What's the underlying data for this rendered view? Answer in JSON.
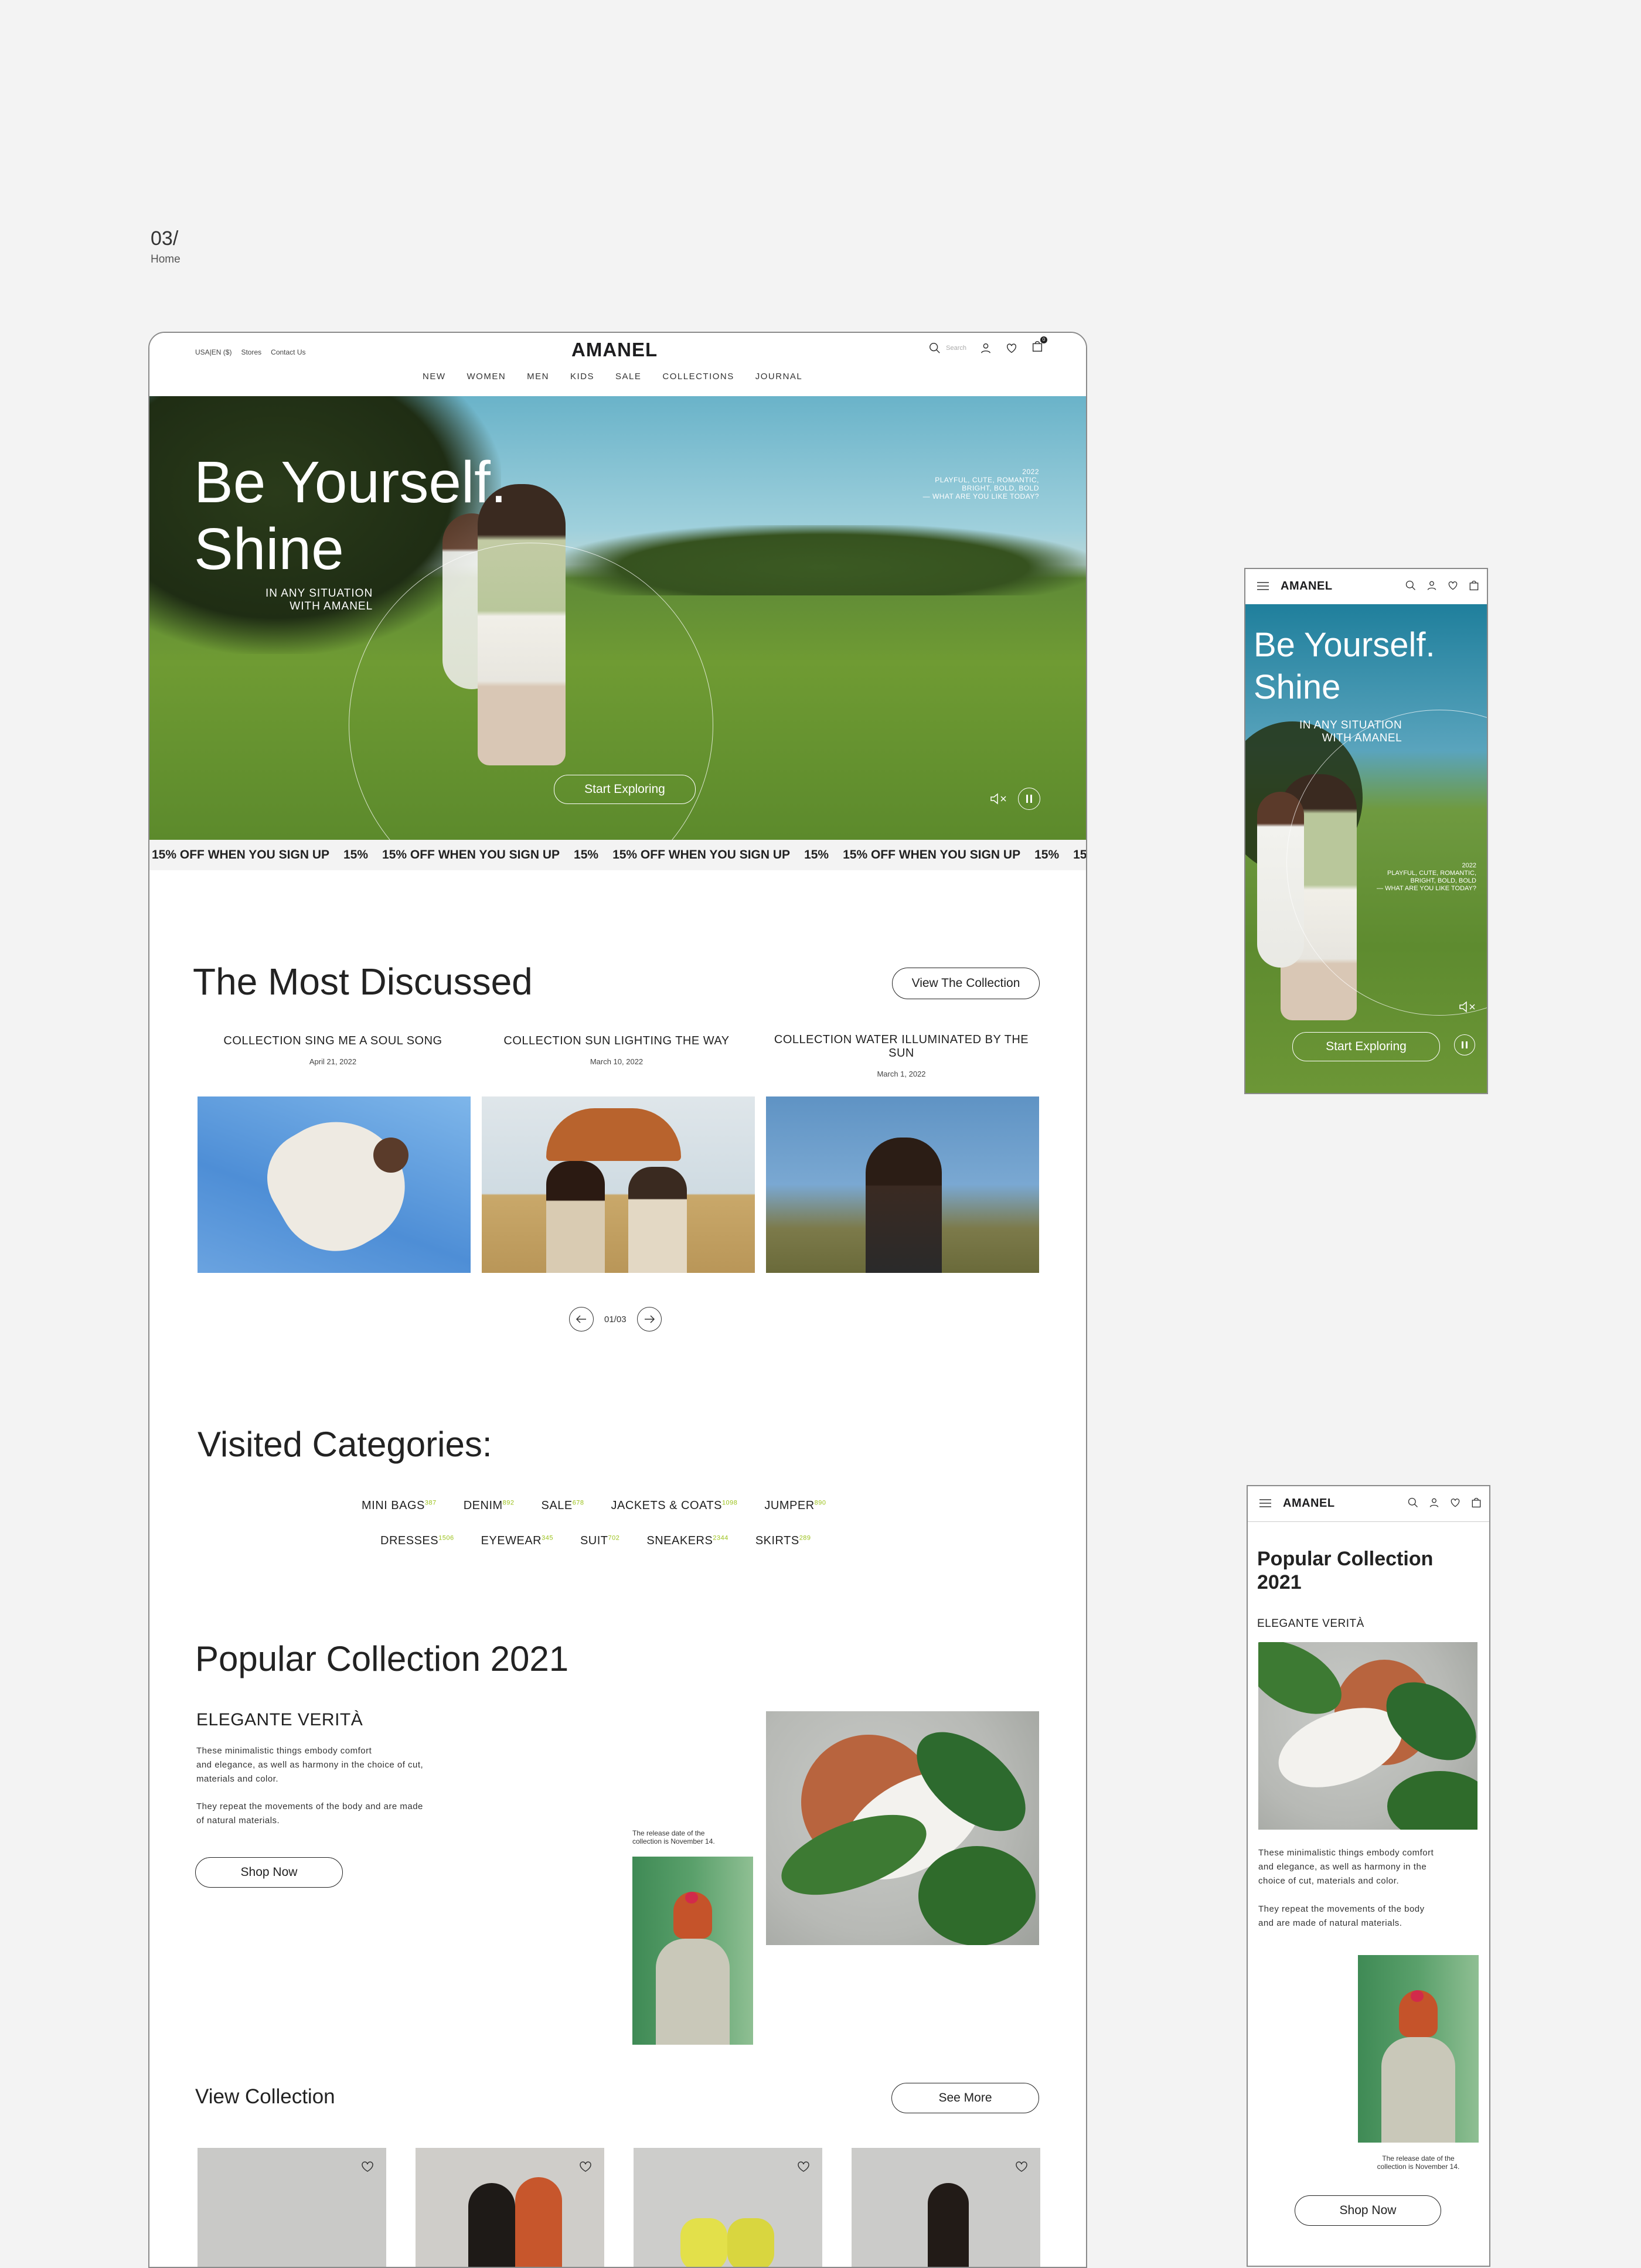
{
  "page": {
    "number": "03/",
    "name": "Home"
  },
  "desktop": {
    "topbar": {
      "locale": "USA|EN ($)",
      "stores": "Stores",
      "contact": "Contact Us",
      "logo": "AMANEL",
      "search_placeholder": "Search",
      "cart_count": "0"
    },
    "nav": [
      "NEW",
      "WOMEN",
      "MEN",
      "KIDS",
      "SALE",
      "COLLECTIONS",
      "JOURNAL"
    ],
    "hero": {
      "title_line1": "Be Yourself.",
      "title_line2": "Shine",
      "sub_line1": "IN ANY SITUATION",
      "sub_line2": "WITH AMANEL",
      "side_line1": "2022",
      "side_line2": "PLAYFUL, CUTE, ROMANTIC,",
      "side_line3": "BRIGHT, BOLD, BOLD",
      "side_line4": "— WHAT ARE YOU LIKE TODAY?",
      "button": "Start Exploring"
    },
    "ticker": "15% OFF WHEN YOU SIGN UP",
    "discussed": {
      "title": "The Most Discussed",
      "button": "View The Collection",
      "items": [
        {
          "title": "COLLECTION SING ME A SOUL SONG",
          "date": "April 21, 2022"
        },
        {
          "title": "COLLECTION  SUN LIGHTING THE WAY",
          "date": "March 10, 2022"
        },
        {
          "title": "COLLECTION WATER ILLUMINATED BY THE SUN",
          "date": "March 1, 2022"
        }
      ],
      "pager": "01/03"
    },
    "categories": {
      "title": "Visited Categories:",
      "row1": [
        {
          "name": "MINI BAGS",
          "count": "387"
        },
        {
          "name": "DENIM",
          "count": "892"
        },
        {
          "name": "SALE",
          "count": "678"
        },
        {
          "name": "JACKETS & COATS",
          "count": "1098"
        },
        {
          "name": "JUMPER",
          "count": "890"
        }
      ],
      "row2": [
        {
          "name": "DRESSES",
          "count": "1506"
        },
        {
          "name": "EYEWEAR",
          "count": "345"
        },
        {
          "name": "SUIT",
          "count": "702"
        },
        {
          "name": "SNEAKERS",
          "count": "2344"
        },
        {
          "name": "SKIRTS",
          "count": "289"
        }
      ]
    },
    "popular": {
      "title": "Popular Collection 2021",
      "subtitle": "ELEGANTE VERITÀ",
      "p1_line1": "These minimalistic things embody comfort",
      "p1_line2": "and elegance, as well as harmony in the choice of cut,",
      "p1_line3": "materials and color.",
      "p2_line1": "They repeat the movements of the body and are made",
      "p2_line2": "of natural materials.",
      "button": "Shop Now",
      "release_line1": "The release date of the",
      "release_line2": "collection is November 14."
    },
    "view_collection": {
      "title": "View Collection",
      "button": "See More"
    }
  },
  "mobile1": {
    "logo": "AMANEL",
    "title_line1": "Be Yourself.",
    "title_line2": "Shine",
    "sub_line1": "IN ANY SITUATION",
    "sub_line2": "WITH AMANEL",
    "side_line1": "2022",
    "side_line2": "PLAYFUL, CUTE, ROMANTIC,",
    "side_line3": "BRIGHT, BOLD, BOLD",
    "side_line4": "— WHAT ARE YOU LIKE TODAY?",
    "button": "Start Exploring"
  },
  "mobile2": {
    "logo": "AMANEL",
    "title_line1": "Popular Collection",
    "title_line2": "2021",
    "subtitle": "ELEGANTE VERITÀ",
    "p1_line1": "These minimalistic things embody comfort",
    "p1_line2": "and elegance, as well as harmony in the",
    "p1_line3": "choice of cut, materials and color.",
    "p2_line1": "They repeat the movements of the body",
    "p2_line2": "and are made of natural materials.",
    "release_line1": "The release date of the",
    "release_line2": "collection is November 14.",
    "button": "Shop Now"
  },
  "colors": {
    "accent_count": "#9bc21a",
    "frame_border": "#8a8a8a",
    "text": "#1d1d1f",
    "background": "#f3f3f3"
  }
}
